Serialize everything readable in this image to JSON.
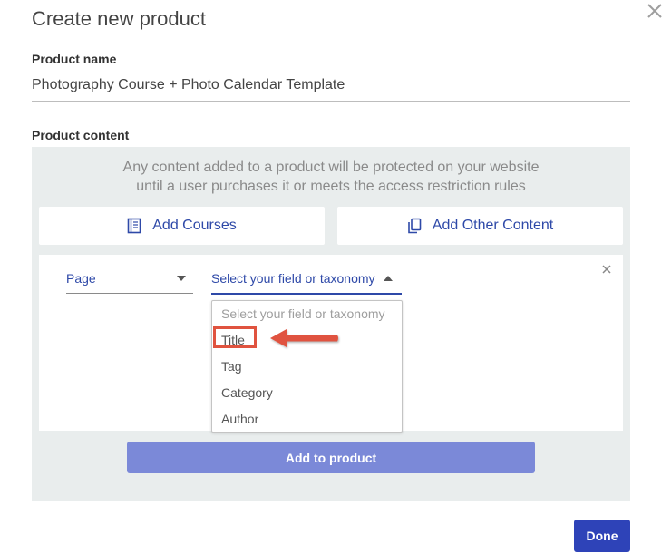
{
  "dialog": {
    "title": "Create new product",
    "close_icon": "close-icon"
  },
  "product_name": {
    "label": "Product name",
    "value": "Photography Course + Photo Calendar Template"
  },
  "product_content": {
    "label": "Product content",
    "note_line1": "Any content added to a product will be protected on your website",
    "note_line2": "until a user purchases it or meets the access restriction rules",
    "add_courses_label": "Add Courses",
    "add_courses_icon": "book-icon",
    "add_other_label": "Add Other Content",
    "add_other_icon": "copy-icon"
  },
  "rule": {
    "type_select_value": "Page",
    "field_select_value": "Select your field or taxonomy",
    "remove_icon": "close-icon",
    "dropdown_options": [
      {
        "label": "Select your field or taxonomy",
        "placeholder": true
      },
      {
        "label": "Title",
        "highlighted": true
      },
      {
        "label": "Tag"
      },
      {
        "label": "Category"
      },
      {
        "label": "Author"
      }
    ]
  },
  "buttons": {
    "add_to_product": "Add to product",
    "done": "Done"
  },
  "colors": {
    "accent": "#2e49a8",
    "panel_bg": "#e9eded",
    "add_button_bg": "#7b89d8",
    "done_button_bg": "#2e43b8",
    "annotation_red": "#e0533f"
  }
}
